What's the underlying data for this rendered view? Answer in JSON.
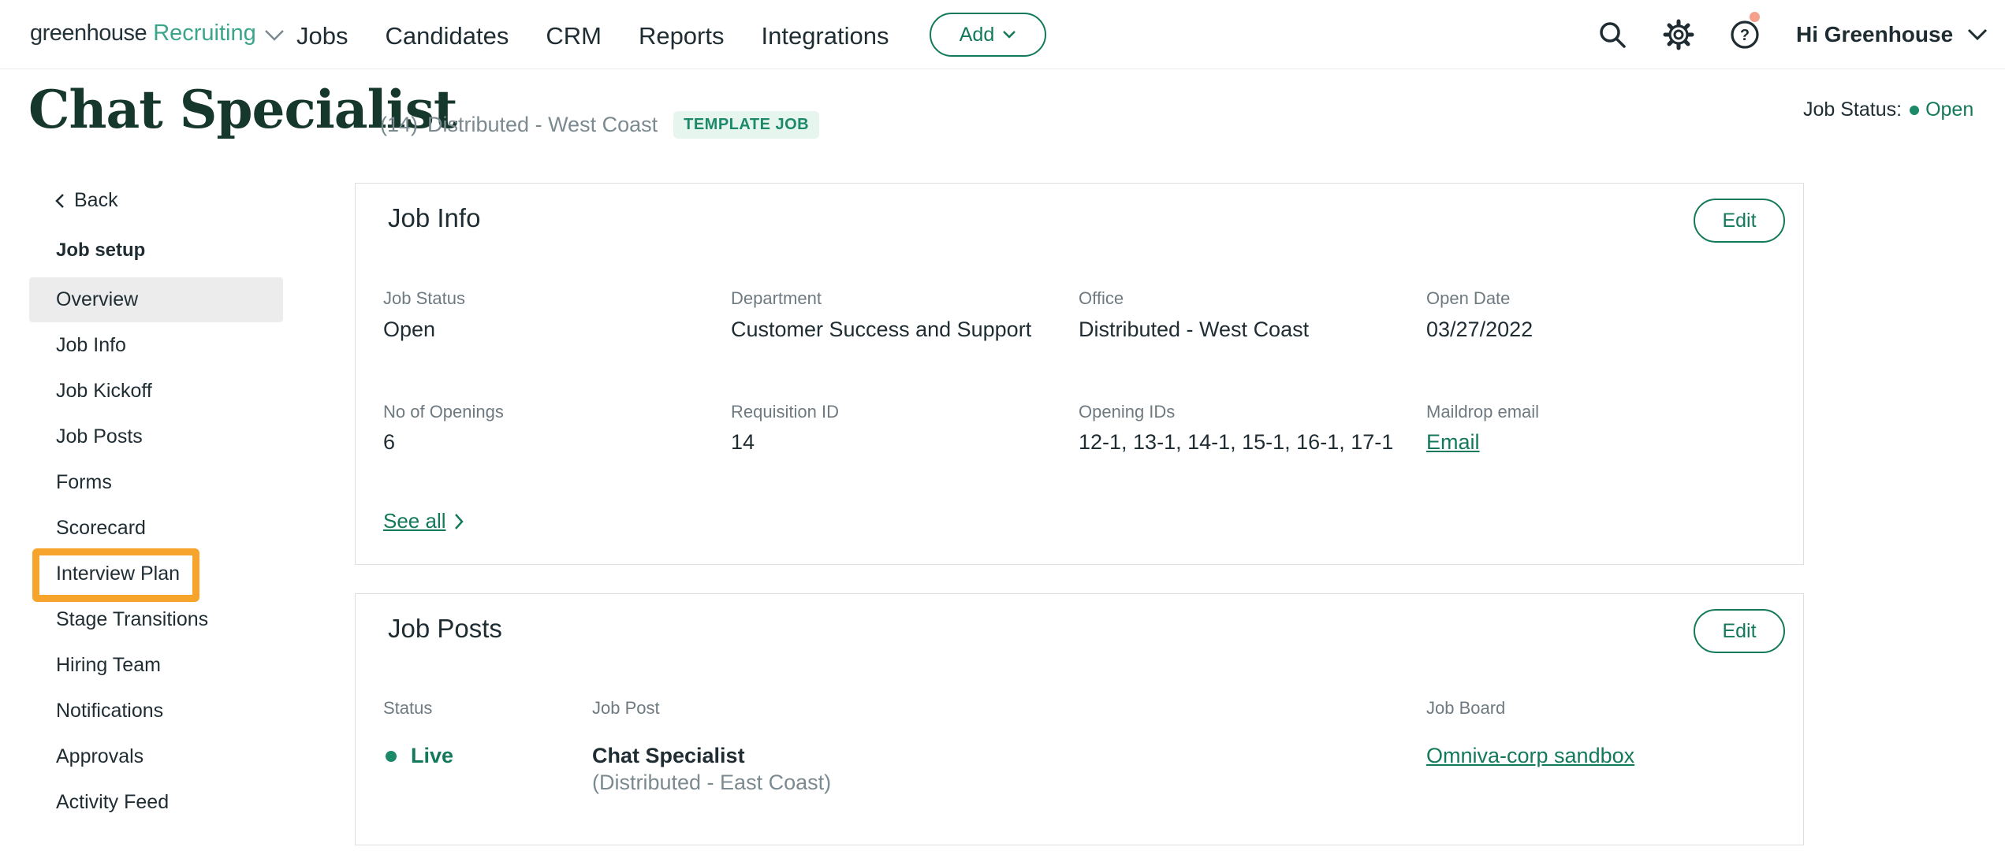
{
  "nav": {
    "brand": "greenhouse",
    "product": "Recruiting",
    "links": [
      "Jobs",
      "Candidates",
      "CRM",
      "Reports",
      "Integrations"
    ],
    "add_label": "Add",
    "greeting": "Hi Greenhouse",
    "icons": [
      "search-icon",
      "gear-icon",
      "help-icon"
    ]
  },
  "header": {
    "title": "Chat Specialist",
    "count": "(14)",
    "location": "Distributed - West Coast",
    "badge": "TEMPLATE JOB",
    "status_label": "Job Status:",
    "status_value": "Open"
  },
  "sidebar": {
    "back_label": "Back",
    "section_title": "Job setup",
    "items": [
      "Overview",
      "Job Info",
      "Job Kickoff",
      "Job Posts",
      "Forms",
      "Scorecard",
      "Interview Plan",
      "Stage Transitions",
      "Hiring Team",
      "Notifications",
      "Approvals",
      "Activity Feed"
    ],
    "active": "Overview",
    "highlighted": "Interview Plan"
  },
  "job_info": {
    "title": "Job Info",
    "edit_label": "Edit",
    "fields": [
      {
        "label": "Job Status",
        "value": "Open"
      },
      {
        "label": "Department",
        "value": "Customer Success and Support"
      },
      {
        "label": "Office",
        "value": "Distributed - West Coast"
      },
      {
        "label": "Open Date",
        "value": "03/27/2022"
      },
      {
        "label": "No of Openings",
        "value": "6"
      },
      {
        "label": "Requisition ID",
        "value": "14"
      },
      {
        "label": "Opening IDs",
        "value": "12-1, 13-1, 14-1, 15-1, 16-1, 17-1"
      },
      {
        "label": "Maildrop email",
        "value": "Email"
      }
    ],
    "see_all": "See all"
  },
  "job_posts": {
    "title": "Job Posts",
    "edit_label": "Edit",
    "columns": [
      "Status",
      "Job Post",
      "Job Board"
    ],
    "rows": [
      {
        "status": "Live",
        "post_name": "Chat Specialist",
        "post_location": "(Distributed - East Coast)",
        "board": "Omniva-corp sandbox"
      }
    ]
  },
  "colors": {
    "accent": "#13795b",
    "highlight": "#f7a42c",
    "badge_bg": "#e7f5ef"
  }
}
